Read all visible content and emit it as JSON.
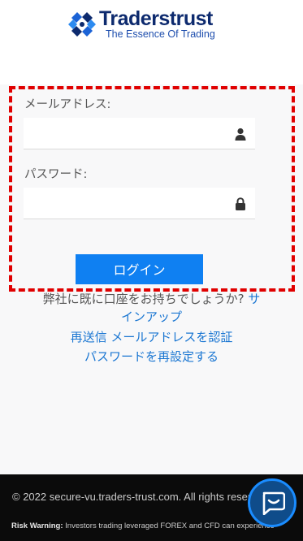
{
  "brand": {
    "name": "Traderstrust",
    "tagline": "The Essence Of Trading"
  },
  "form": {
    "email_label": "メールアドレス:",
    "email_value": "",
    "password_label": "パスワード:",
    "password_value": "",
    "login_button": "ログイン"
  },
  "links": {
    "signup_prompt": "弊社に既に口座をお持ちでしょうか?",
    "signup_link_part1": "サ",
    "signup_link_part2": "インアップ",
    "resend_verify": "再送信 メールアドレスを認証",
    "reset_password": "パスワードを再設定する"
  },
  "footer": {
    "copyright": "© 2022 secure-vu.traders-trust.com. All rights reserved.",
    "risk_label": "Risk Warning:",
    "risk_text": " Investors trading leveraged FOREX and CFD can experience"
  },
  "icons": {
    "email_field_icon": "user-icon",
    "password_field_icon": "lock-icon",
    "chat_icon": "chat-bubble-icon"
  },
  "colors": {
    "primary_button": "#0f80f2",
    "link": "#1a76d2",
    "highlight_border": "#e00000",
    "footer_bg": "#0b0b0b",
    "brand_navy": "#0d2a6e"
  }
}
